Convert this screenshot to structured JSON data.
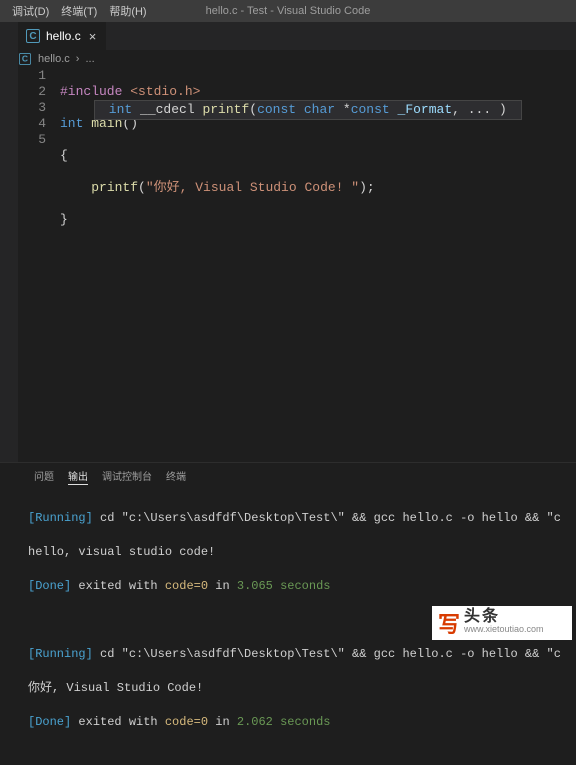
{
  "menu": {
    "debug": "调试(D)",
    "terminal": "终端(T)",
    "help": "帮助(H)"
  },
  "window_title": "hello.c - Test - Visual Studio Code",
  "tab": {
    "filename": "hello.c",
    "icon": "C"
  },
  "breadcrumb": {
    "file": "hello.c",
    "sep": "›",
    "more": "..."
  },
  "gutter": [
    "1",
    "2",
    "3",
    "4",
    "5"
  ],
  "code": {
    "l1_macro": "#include",
    "l1_inc": " <stdio.h>",
    "l2_kw": "int",
    "l2_fn": " main",
    "l2_par": "()",
    "l3": "{",
    "l4_indent": "    ",
    "l4_fn": "printf",
    "l4_p1": "(",
    "l4_str": "\"你好, Visual Studio Code! \"",
    "l4_p2": ");",
    "l5": "}"
  },
  "hint": {
    "t1": " int",
    "t2": " __cdecl ",
    "fn": "printf",
    "t3": "(",
    "t4": "const",
    "t5": " char",
    "t6": " *",
    "t7": "const",
    "t8": " _Format",
    "t9": ", ... ) "
  },
  "panel_tabs": {
    "problems": "问题",
    "output": "输出",
    "debug": "调试控制台",
    "terminal": "终端"
  },
  "terminal": {
    "r1_tag": "[Running]",
    "r1_cmd": " cd \"c:\\Users\\asdfdf\\Desktop\\Test\\\" && gcc hello.c -o hello && \"c",
    "r1_out": "hello, visual studio code!",
    "r1_done": "[Done]",
    "r1_done_txt1": " exited with ",
    "r1_code": "code=0",
    "r1_done_txt2": " in ",
    "r1_secs": "3.065 seconds",
    "r2_tag": "[Running]",
    "r2_cmd": " cd \"c:\\Users\\asdfdf\\Desktop\\Test\\\" && gcc hello.c -o hello && \"c",
    "r2_out": "你好, Visual Studio Code!",
    "r2_done": "[Done]",
    "r2_done_txt1": " exited with ",
    "r2_code": "code=0",
    "r2_done_txt2": " in ",
    "r2_secs": "2.062 seconds"
  },
  "watermark": {
    "logo": "写",
    "big": "头条",
    "url": "www.xietoutiao.com"
  }
}
